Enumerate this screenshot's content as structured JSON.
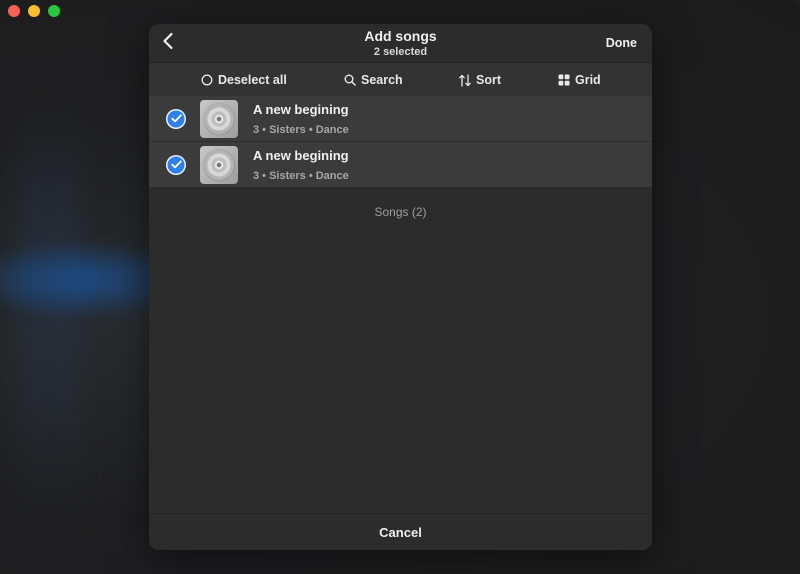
{
  "window": {
    "traffic_lights": [
      "close",
      "minimize",
      "maximize"
    ]
  },
  "sheet": {
    "title": "Add songs",
    "subtitle": "2 selected",
    "back_icon": "chevron-left-icon",
    "done_label": "Done"
  },
  "toolbar": {
    "deselect_label": "Deselect all",
    "search_label": "Search",
    "sort_label": "Sort",
    "grid_label": "Grid",
    "icons": [
      "circle-icon",
      "search-icon",
      "sort-icon",
      "grid-icon"
    ]
  },
  "songs": [
    {
      "title": "A new begining",
      "meta": "3 • Sisters • Dance",
      "selected": true
    },
    {
      "title": "A new begining",
      "meta": "3 • Sisters • Dance",
      "selected": true
    }
  ],
  "songs_count_label": "Songs (2)",
  "cancel_label": "Cancel",
  "colors": {
    "accent": "#2f80ed",
    "sheet_bg": "#2c2c2c",
    "row_bg": "#3b3b3b",
    "toolbar_bg": "#333333"
  }
}
